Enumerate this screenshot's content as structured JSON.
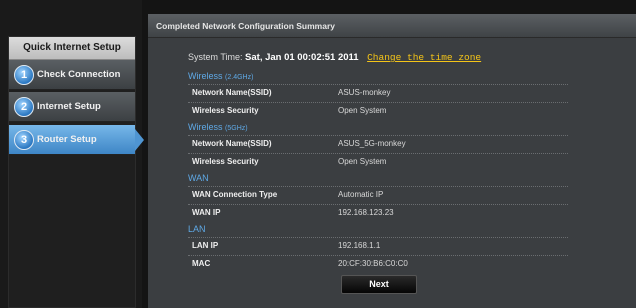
{
  "sidebar": {
    "title": "Quick Internet Setup",
    "steps": [
      {
        "num": "1",
        "label": "Check Connection"
      },
      {
        "num": "2",
        "label": "Internet Setup"
      },
      {
        "num": "3",
        "label": "Router Setup"
      }
    ]
  },
  "main": {
    "title": "Completed Network Configuration Summary",
    "system_time_label": "System Time:",
    "system_time_value": "Sat, Jan 01 00:02:51 2011",
    "change_tz_link": "Change the time zone",
    "sections": {
      "wireless24": {
        "title": "Wireless",
        "band": "(2.4GHz)",
        "rows": [
          {
            "label": "Network Name(SSID)",
            "value": "ASUS-monkey"
          },
          {
            "label": "Wireless Security",
            "value": "Open System"
          }
        ]
      },
      "wireless5": {
        "title": "Wireless",
        "band": "(5GHz)",
        "rows": [
          {
            "label": "Network Name(SSID)",
            "value": "ASUS_5G-monkey"
          },
          {
            "label": "Wireless Security",
            "value": "Open System"
          }
        ]
      },
      "wan": {
        "title": "WAN",
        "rows": [
          {
            "label": "WAN Connection Type",
            "value": "Automatic IP"
          },
          {
            "label": "WAN IP",
            "value": "192.168.123.23"
          }
        ]
      },
      "lan": {
        "title": "LAN",
        "rows": [
          {
            "label": "LAN IP",
            "value": "192.168.1.1"
          },
          {
            "label": "MAC",
            "value": "20:CF:30:B6:C0:C0"
          }
        ]
      }
    },
    "next_button": "Next"
  },
  "colors": {
    "accent": "#5fa9e6",
    "link": "#f5c518",
    "active_step": "#4f95d2"
  }
}
